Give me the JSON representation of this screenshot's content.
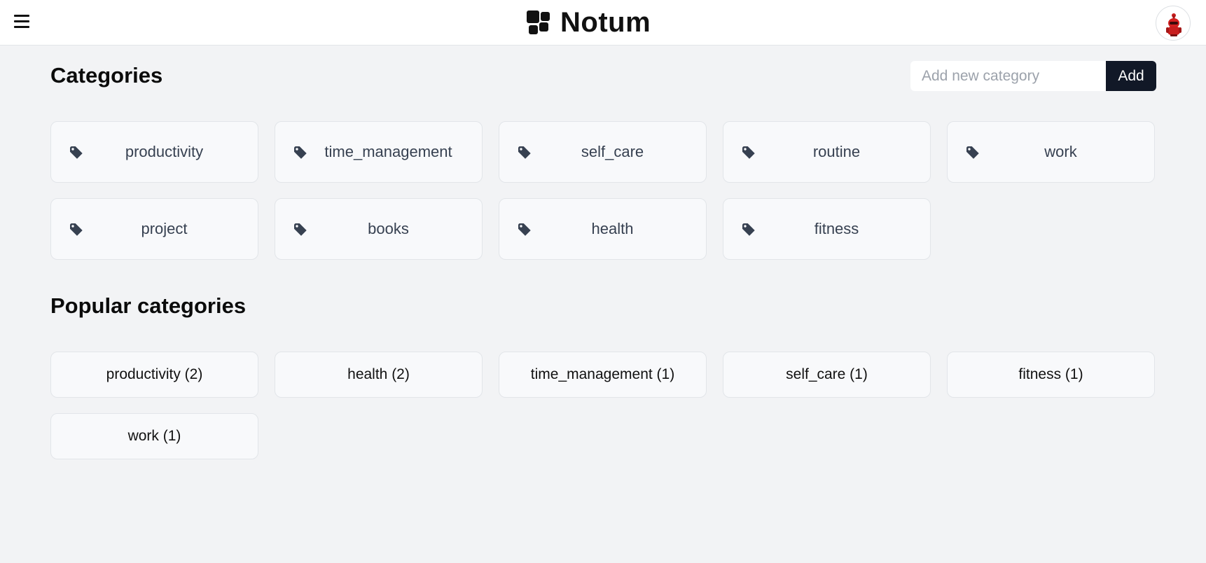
{
  "header": {
    "app_title": "Notum",
    "menu_icon": "hamburger-menu-icon",
    "logo_icon": "squares-logo-icon",
    "avatar_icon": "red-robot-avatar"
  },
  "categories": {
    "title": "Categories",
    "input_placeholder": "Add new category",
    "add_label": "Add",
    "items": [
      {
        "label": "productivity"
      },
      {
        "label": "time_management"
      },
      {
        "label": "self_care"
      },
      {
        "label": "routine"
      },
      {
        "label": "work"
      },
      {
        "label": "project"
      },
      {
        "label": "books"
      },
      {
        "label": "health"
      },
      {
        "label": "fitness"
      }
    ]
  },
  "popular": {
    "title": "Popular categories",
    "items": [
      {
        "label": "productivity (2)"
      },
      {
        "label": "health (2)"
      },
      {
        "label": "time_management (1)"
      },
      {
        "label": "self_care (1)"
      },
      {
        "label": "fitness (1)"
      },
      {
        "label": "work (1)"
      }
    ]
  },
  "colors": {
    "background": "#f2f3f5",
    "card": "#f8f9fb",
    "button": "#111827",
    "tag_icon": "#374151"
  }
}
